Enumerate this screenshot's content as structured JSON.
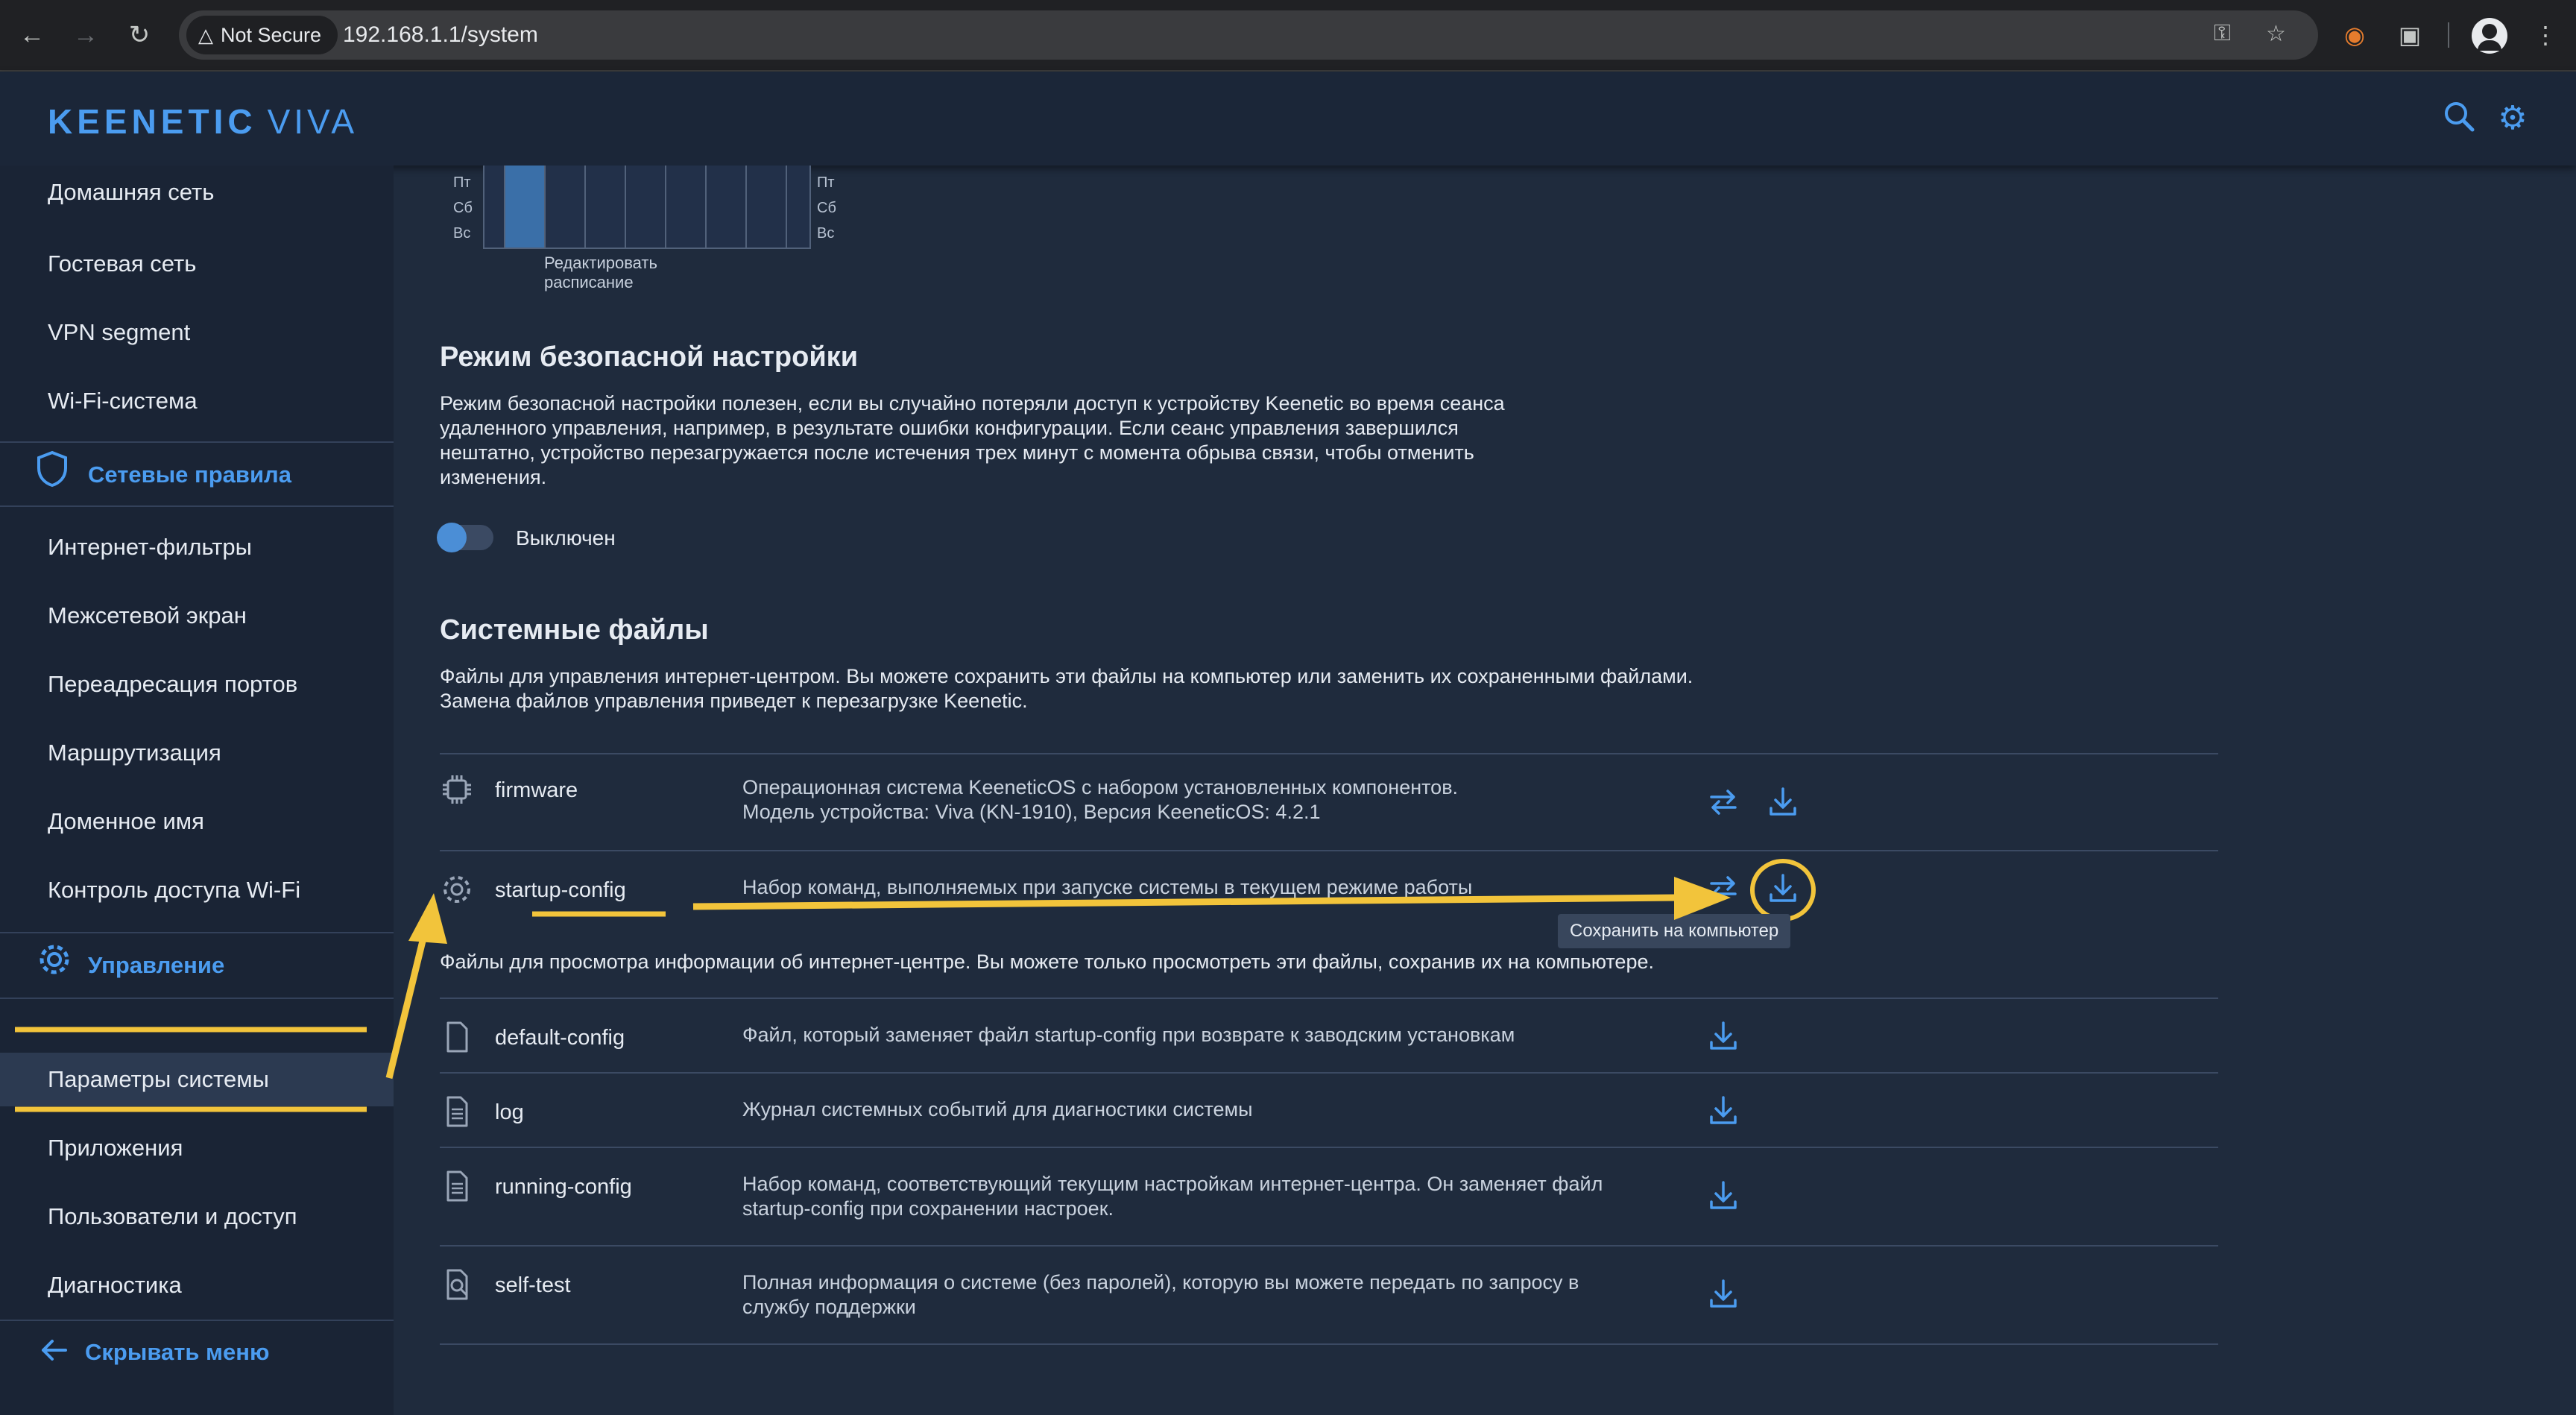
{
  "browser": {
    "not_secure_label": "Not Secure",
    "url": "192.168.1.1/system"
  },
  "app": {
    "brand": "KEENETIC",
    "model": "VIVA"
  },
  "sidebar": {
    "items_top": [
      {
        "label": "Домашняя сеть"
      },
      {
        "label": "Гостевая сеть"
      },
      {
        "label": "VPN segment"
      },
      {
        "label": "Wi-Fi-система"
      }
    ],
    "section_network_rules": "Сетевые правила",
    "items_rules": [
      {
        "label": "Интернет-фильтры"
      },
      {
        "label": "Межсетевой экран"
      },
      {
        "label": "Переадресация портов"
      },
      {
        "label": "Маршрутизация"
      },
      {
        "label": "Доменное имя"
      },
      {
        "label": "Контроль доступа Wi-Fi"
      }
    ],
    "section_management": "Управление",
    "items_management": [
      {
        "label": "Параметры системы",
        "active": true
      },
      {
        "label": "Приложения"
      },
      {
        "label": "Пользователи и доступ"
      },
      {
        "label": "Диагностика"
      }
    ],
    "hide_menu": "Скрывать меню"
  },
  "schedule": {
    "days": [
      "Пт",
      "Сб",
      "Вс"
    ],
    "edit_link": "Редактировать расписание"
  },
  "safe_mode": {
    "title": "Режим безопасной настройки",
    "description_lines": [
      "Режим безопасной настройки полезен, если вы случайно потеряли доступ к устройству Keenetic во время сеанса",
      "удаленного управления, например, в результате ошибки конфигурации. Если сеанс управления завершился",
      "нештатно, устройство перезагружается после истечения трех минут с момента обрыва связи, чтобы отменить",
      "изменения."
    ],
    "toggle_label": "Выключен",
    "toggle_on": false
  },
  "system_files": {
    "title": "Системные файлы",
    "description_lines": [
      "Файлы для управления интернет-центром. Вы можете сохранить эти файлы на компьютер или заменить их сохраненными файлами.",
      "Замена файлов управления приведет к перезагрузке Keenetic."
    ],
    "managed_files": [
      {
        "name": "firmware",
        "icon": "chip-icon",
        "desc_lines": [
          "Операционная система KeeneticOS с набором установленных компонентов.",
          "Модель устройства: Viva (KN-1910), Версия KeeneticOS: 4.2.1"
        ]
      },
      {
        "name": "startup-config",
        "icon": "gear-file-icon",
        "desc_lines": [
          "Набор команд, выполняемых при запуске системы в текущем режиме работы"
        ]
      }
    ],
    "tooltip": "Сохранить на компьютер",
    "view_description": "Файлы для просмотра информации об интернет-центре. Вы можете только просмотреть эти файлы, сохранив их на компьютере.",
    "view_files": [
      {
        "name": "default-config",
        "icon": "file-icon",
        "desc_lines": [
          "Файл, который заменяет файл startup-config при возврате к заводским установкам"
        ]
      },
      {
        "name": "log",
        "icon": "document-icon",
        "desc_lines": [
          "Журнал системных событий для диагностики системы"
        ]
      },
      {
        "name": "running-config",
        "icon": "document-icon",
        "desc_lines": [
          "Набор команд, соответствующий текущим настройкам интернет-центра. Он заменяет файл",
          "startup-config при сохранении настроек."
        ]
      },
      {
        "name": "self-test",
        "icon": "magnifier-file-icon",
        "desc_lines": [
          "Полная информация о системе (без паролей), которую вы можете передать по запросу в",
          "службу поддержки"
        ]
      }
    ]
  },
  "colors": {
    "accent": "#4b9cf0",
    "annotation": "#f2c43b",
    "background": "#1f2b3d"
  }
}
